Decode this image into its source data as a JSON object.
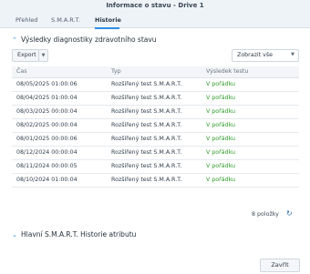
{
  "window": {
    "title": "Informace o stavu - Drive 1"
  },
  "tabs": [
    {
      "label": "Přehled"
    },
    {
      "label": "S.M.A.R.T."
    },
    {
      "label": "Historie"
    }
  ],
  "results_section": {
    "title": "Výsledky diagnostiky zdravotního stavu"
  },
  "toolbar": {
    "export_label": "Export",
    "filter_value": "Zobrazit vše"
  },
  "table": {
    "headers": [
      "Čas",
      "Typ",
      "Výsledek testu"
    ],
    "rows": [
      {
        "time": "08/05/2025 01:00:06",
        "type": "Rozšířený test S.M.A.R.T.",
        "result": "V pořádku"
      },
      {
        "time": "08/04/2025 01:00:04",
        "type": "Rozšířený test S.M.A.R.T.",
        "result": "V pořádku"
      },
      {
        "time": "08/03/2025 00:00:04",
        "type": "Rozšířený test S.M.A.R.T.",
        "result": "V pořádku"
      },
      {
        "time": "08/02/2025 00:00:04",
        "type": "Rozšířený test S.M.A.R.T.",
        "result": "V pořádku"
      },
      {
        "time": "08/01/2025 00:00:06",
        "type": "Rozšířený test S.M.A.R.T.",
        "result": "V pořádku"
      },
      {
        "time": "08/12/2024 00:00:04",
        "type": "Rozšířený test S.M.A.R.T.",
        "result": "V pořádku"
      },
      {
        "time": "08/11/2024 00:00:05",
        "type": "Rozšířený test S.M.A.R.T.",
        "result": "V pořádku"
      },
      {
        "time": "08/10/2024 01:00:04",
        "type": "Rozšířený test S.M.A.R.T.",
        "result": "V pořádku"
      }
    ],
    "footer_count": "8 položky"
  },
  "history_section": {
    "title": "Hlavní S.M.A.R.T. Historie atributu"
  },
  "footer": {
    "close_label": "Zavřít"
  },
  "icons": {
    "expand": "chevron-up-icon",
    "collapse": "chevron-down-icon",
    "refresh": "refresh-icon",
    "dropdown": "caret-down-icon"
  },
  "colors": {
    "accent": "#2f8ce8",
    "ok": "#2e9b2a"
  }
}
